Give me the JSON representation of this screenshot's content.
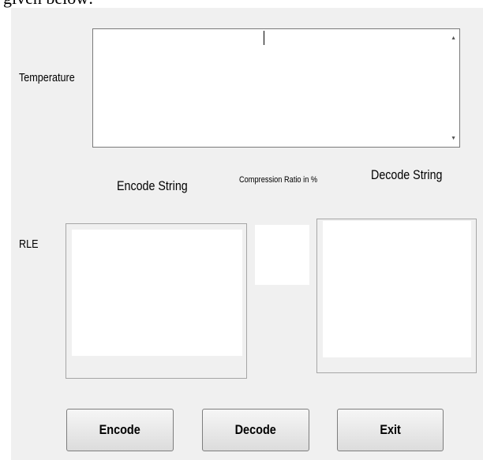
{
  "caption": "given below:",
  "labels": {
    "temperature": "Temperature",
    "rle": "RLE",
    "encode_string": "Encode String",
    "compression_ratio": "Compression Ratio in %",
    "decode_string": "Decode String"
  },
  "fields": {
    "temperature_value": "",
    "encoded_value": "",
    "ratio_value": "",
    "decoded_value": ""
  },
  "buttons": {
    "encode": "Encode",
    "decode": "Decode",
    "exit": "Exit"
  },
  "icons": {
    "scroll_up": "triangle-up",
    "scroll_down": "triangle-down"
  }
}
